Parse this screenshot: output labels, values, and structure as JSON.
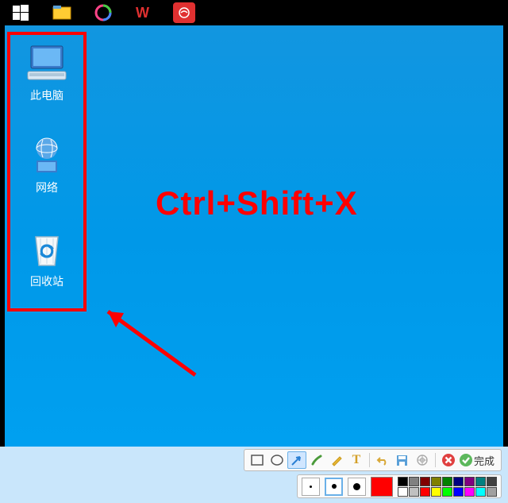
{
  "taskbar": {
    "items": [
      "start",
      "file-explorer",
      "swirl-app",
      "wps",
      "record"
    ]
  },
  "desktop": {
    "icons": [
      {
        "id": "pc",
        "label": "此电脑"
      },
      {
        "id": "net",
        "label": "网络"
      },
      {
        "id": "bin",
        "label": "回收站"
      }
    ],
    "overlay_text": "Ctrl+Shift+X",
    "highlight_color": "#ff0000"
  },
  "snip_toolbar": {
    "tools": [
      {
        "id": "rect",
        "icon": "rect-icon"
      },
      {
        "id": "ellipse",
        "icon": "ellipse-icon"
      },
      {
        "id": "arrow",
        "icon": "arrow-icon",
        "selected": true
      },
      {
        "id": "brush",
        "icon": "brush-icon"
      },
      {
        "id": "pen",
        "icon": "pen-icon"
      },
      {
        "id": "text",
        "icon": "text-icon"
      }
    ],
    "actions": [
      {
        "id": "undo",
        "icon": "undo-icon"
      },
      {
        "id": "save",
        "icon": "save-icon"
      },
      {
        "id": "share",
        "icon": "share-icon"
      }
    ],
    "cancel": {
      "icon": "cancel-icon",
      "color": "#e04040"
    },
    "done": {
      "icon": "done-icon",
      "color": "#5cb85c",
      "label": "完成"
    }
  },
  "palette": {
    "sizes": [
      {
        "px": 3
      },
      {
        "px": 6,
        "selected": true
      },
      {
        "px": 9
      }
    ],
    "current_color": "#ff0000",
    "colors_row1": [
      "#000000",
      "#808080",
      "#800000",
      "#808000",
      "#008000",
      "#000080",
      "#800080",
      "#008080",
      "#404040"
    ],
    "colors_row2": [
      "#ffffff",
      "#c0c0c0",
      "#ff0000",
      "#ffff00",
      "#00ff00",
      "#0000ff",
      "#ff00ff",
      "#00ffff",
      "#a0a0a0"
    ]
  }
}
